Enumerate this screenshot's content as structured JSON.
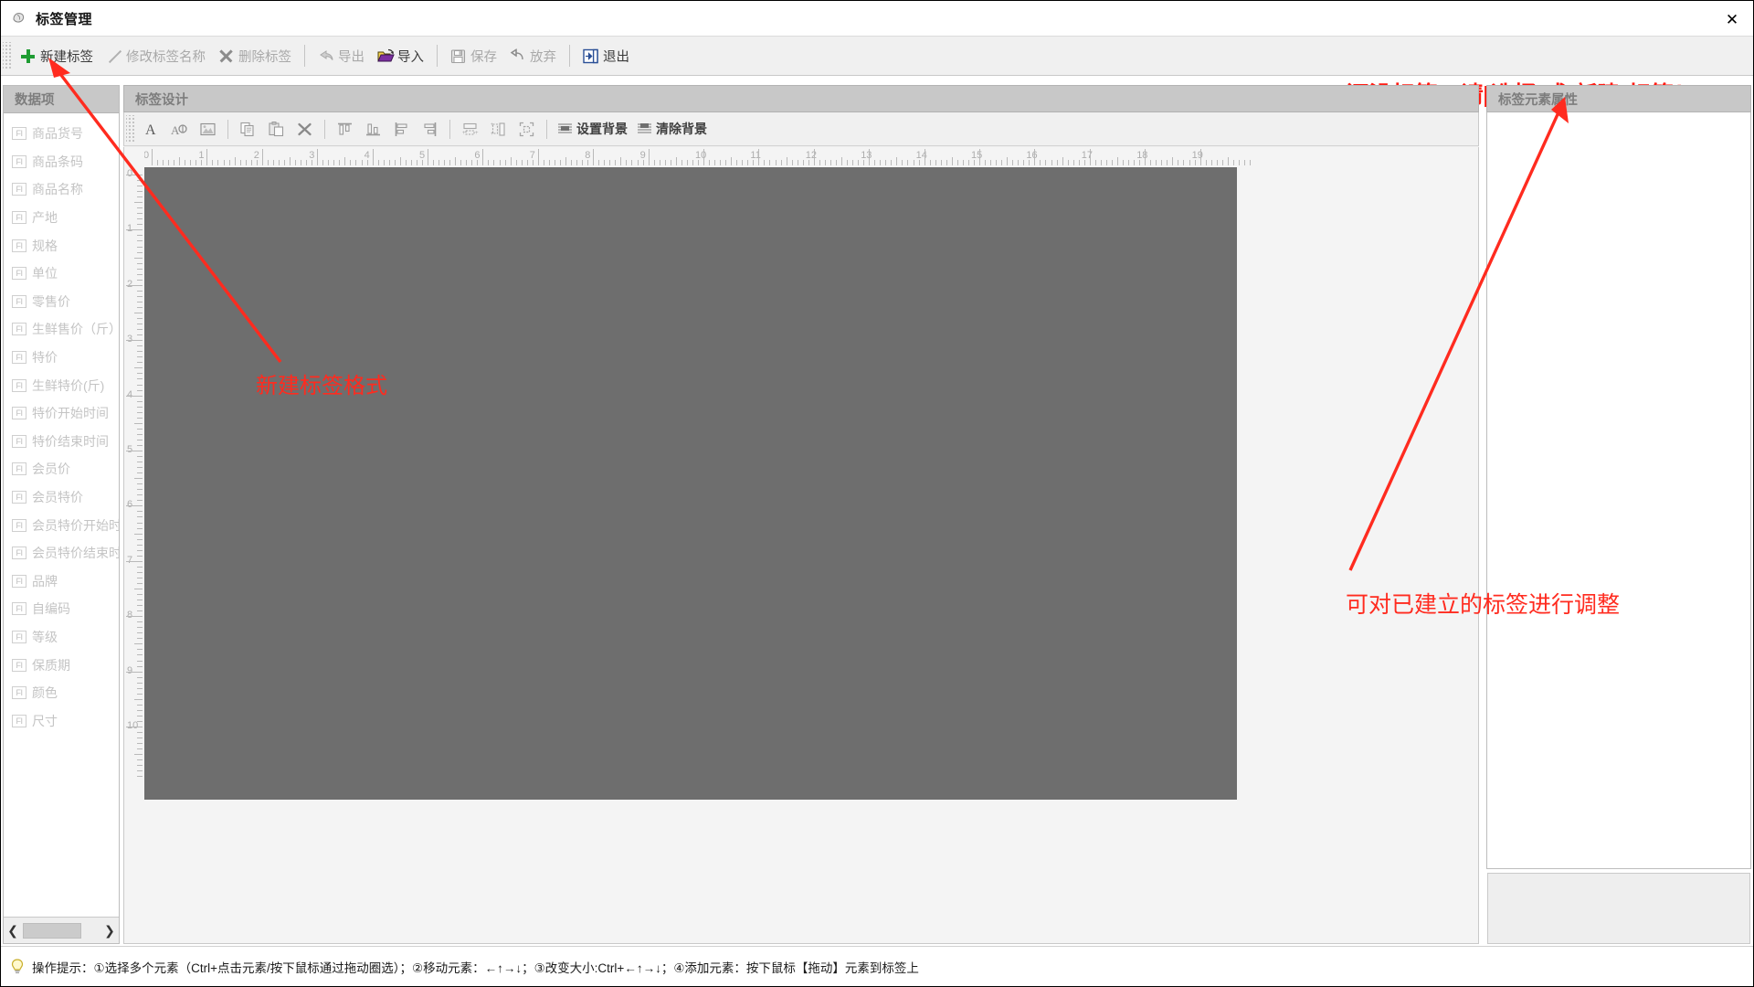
{
  "window": {
    "title": "标签管理",
    "title_icon": "tag-icon",
    "close_label": "✕"
  },
  "toolbar": {
    "items": [
      {
        "label": "新建标签",
        "icon": "plus-icon",
        "enabled": true,
        "name": "new-label-button"
      },
      {
        "label": "修改标签名称",
        "icon": "pencil-icon",
        "enabled": false,
        "name": "rename-label-button"
      },
      {
        "label": "删除标签",
        "icon": "delete-x-icon",
        "enabled": false,
        "name": "delete-label-button"
      },
      {
        "label": "导出",
        "icon": "export-arrow-icon",
        "enabled": false,
        "name": "export-button"
      },
      {
        "label": "导入",
        "icon": "folder-open-icon",
        "enabled": true,
        "name": "import-button"
      },
      {
        "label": "保存",
        "icon": "floppy-disk-icon",
        "enabled": false,
        "name": "save-button"
      },
      {
        "label": "放弃",
        "icon": "undo-icon",
        "enabled": false,
        "name": "discard-button"
      },
      {
        "label": "退出",
        "icon": "exit-icon",
        "enabled": true,
        "name": "exit-button"
      }
    ]
  },
  "hints": {
    "top_warning": "还没标签，请[选择]或[新建]标签！",
    "annotation_canvas": "新建标签格式",
    "annotation_right": "可对已建立的标签进行调整",
    "annotation_color": "#ff2b1f"
  },
  "left_panel": {
    "header": "数据项",
    "badge": "FI",
    "items": [
      "商品货号",
      "商品条码",
      "商品名称",
      "产地",
      "规格",
      "单位",
      "零售价",
      "生鲜售价（斤）",
      "特价",
      "生鲜特价(斤)",
      "特价开始时间",
      "特价结束时间",
      "会员价",
      "会员特价",
      "会员特价开始时间",
      "会员特价结束时间",
      "品牌",
      "自编码",
      "等级",
      "保质期",
      "颜色",
      "尺寸"
    ],
    "scroll_left": "❮",
    "scroll_right": "❯"
  },
  "center_panel": {
    "header": "标签设计",
    "tools": [
      {
        "icon": "text-tool-icon",
        "name": "add-text-tool",
        "label": ""
      },
      {
        "icon": "text-style-tool-icon",
        "name": "text-style-tool",
        "label": ""
      },
      {
        "icon": "image-tool-icon",
        "name": "add-image-tool",
        "label": ""
      },
      {
        "icon": "copy-icon",
        "name": "copy-button",
        "label": ""
      },
      {
        "icon": "paste-icon",
        "name": "paste-button",
        "label": ""
      },
      {
        "icon": "delete-x-icon",
        "name": "delete-element-button",
        "label": ""
      },
      {
        "icon": "align-top-icon",
        "name": "align-top-button",
        "label": ""
      },
      {
        "icon": "align-bottom-icon",
        "name": "align-bottom-button",
        "label": ""
      },
      {
        "icon": "align-left-icon",
        "name": "align-left-button",
        "label": ""
      },
      {
        "icon": "align-right-icon",
        "name": "align-right-button",
        "label": ""
      },
      {
        "icon": "same-width-icon",
        "name": "same-width-button",
        "label": ""
      },
      {
        "icon": "same-height-icon",
        "name": "same-height-button",
        "label": ""
      },
      {
        "icon": "same-size-icon",
        "name": "same-size-button",
        "label": ""
      }
    ],
    "set_background_label": "设置背景",
    "clear_background_label": "清除背景",
    "ruler_h_labels": [
      "0",
      "1",
      "2",
      "3",
      "4",
      "5",
      "6",
      "7",
      "8",
      "9",
      "10",
      "11",
      "12",
      "13",
      "14",
      "15",
      "16",
      "17",
      "18",
      "19"
    ],
    "ruler_v_labels": [
      "0",
      "1",
      "2",
      "3",
      "4",
      "5",
      "6",
      "7",
      "8",
      "9",
      "10"
    ]
  },
  "right_panel": {
    "header": "标签元素属性"
  },
  "status_bar": {
    "icon": "lightbulb-icon",
    "text": "操作提示：①选择多个元素（Ctrl+点击元素/按下鼠标通过拖动圈选）；②移动元素：←↑→↓；③改变大小:Ctrl+←↑→↓；④添加元素：按下鼠标【拖动】元素到标签上"
  }
}
